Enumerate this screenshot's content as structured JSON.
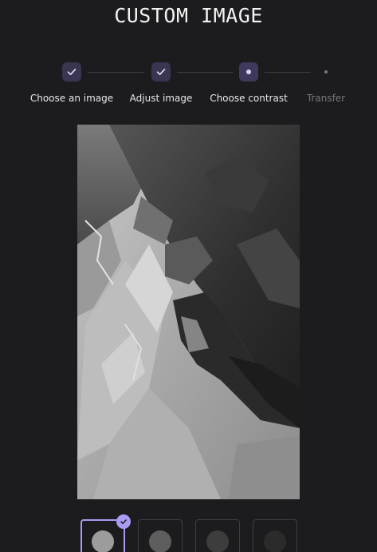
{
  "page": {
    "title": "CUSTOM IMAGE"
  },
  "stepper": {
    "steps": [
      {
        "label": "Choose an image",
        "state": "completed",
        "icon": "check-icon"
      },
      {
        "label": "Adjust image",
        "state": "completed",
        "icon": "check-icon"
      },
      {
        "label": "Choose contrast",
        "state": "current",
        "icon": "dot-icon"
      },
      {
        "label": "Transfer",
        "state": "pending",
        "icon": "dot-icon"
      }
    ]
  },
  "contrast": {
    "options": [
      {
        "swatch_color": "#9c9c9c",
        "selected": true
      },
      {
        "swatch_color": "#5e5e5e",
        "selected": false
      },
      {
        "swatch_color": "#3d3d3d",
        "selected": false
      },
      {
        "swatch_color": "#2b2b2b",
        "selected": false
      }
    ]
  },
  "colors": {
    "accent": "#a99bf2",
    "background": "#1c1c1f",
    "step_active_bg": "#3a3550"
  }
}
